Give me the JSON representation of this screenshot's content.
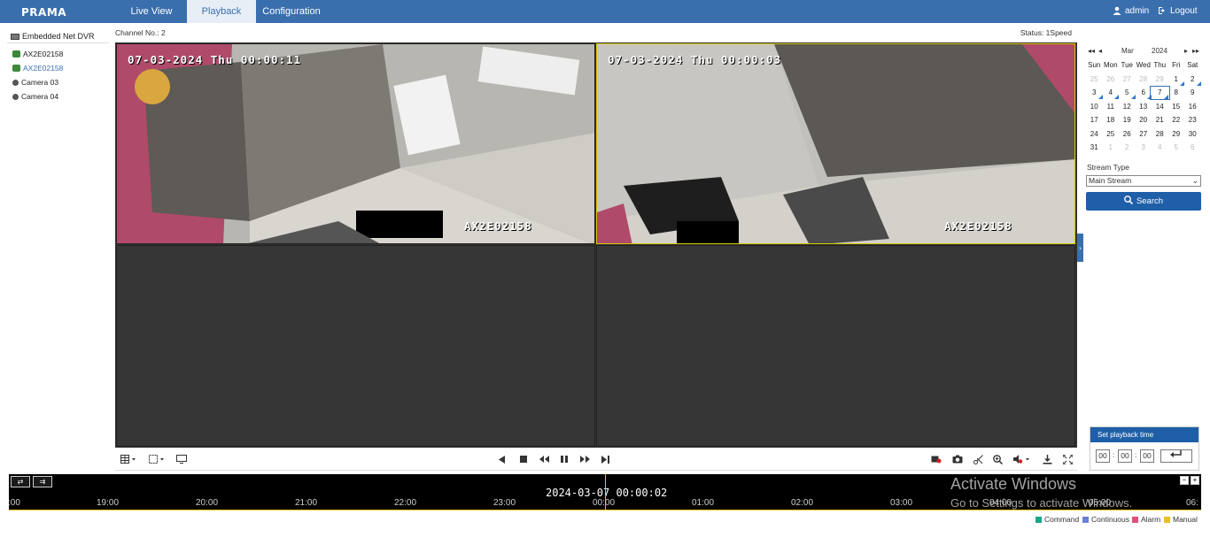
{
  "app": {
    "logo": "PRAMA"
  },
  "nav": {
    "tabs": [
      "Live View",
      "Playback",
      "Configuration"
    ]
  },
  "user": {
    "name": "admin",
    "logout": "Logout"
  },
  "tree": {
    "root": "Embedded Net DVR",
    "channels": [
      "AX2E02158",
      "AX2E02158",
      "Camera 03",
      "Camera 04"
    ]
  },
  "player": {
    "channel_no": "Channel No.: 2",
    "status": "Status: 1Speed",
    "cells": [
      {
        "osd_time": "07-03-2024 Thu 00:00:11",
        "osd_name": "AX2E02158"
      },
      {
        "osd_time": "07-03-2024 Thu 00:00:03",
        "osd_name": "AX2E02158"
      }
    ]
  },
  "calendar": {
    "month": "Mar",
    "year": "2024",
    "weekdays": [
      "Sun",
      "Mon",
      "Tue",
      "Wed",
      "Thu",
      "Fri",
      "Sat"
    ],
    "days": [
      [
        "25",
        "26",
        "27",
        "28",
        "29",
        "1",
        "2"
      ],
      [
        "3",
        "4",
        "5",
        "6",
        "7",
        "8",
        "9"
      ],
      [
        "10",
        "11",
        "12",
        "13",
        "14",
        "15",
        "16"
      ],
      [
        "17",
        "18",
        "19",
        "20",
        "21",
        "22",
        "23"
      ],
      [
        "24",
        "25",
        "26",
        "27",
        "28",
        "29",
        "30"
      ],
      [
        "31",
        "1",
        "2",
        "3",
        "4",
        "5",
        "6"
      ]
    ],
    "selected": "7"
  },
  "stream": {
    "label": "Stream Type",
    "value": "Main Stream"
  },
  "search_label": "Search",
  "playback_time": {
    "title": "Set playback time",
    "h": "00",
    "m": "00",
    "s": "00"
  },
  "timeline": {
    "current": "2024-03-07 00:00:02",
    "ticks": [
      ":00",
      "19:00",
      "20:00",
      "21:00",
      "22:00",
      "23:00",
      "00:00",
      "01:00",
      "02:00",
      "03:00",
      "04:00",
      "05:00",
      "06:"
    ]
  },
  "legend": [
    "Command",
    "Continuous",
    "Alarm",
    "Manual"
  ],
  "colors": {
    "accent": "#3a6fae",
    "command": "#1aa58a",
    "continuous": "#6a7fd8",
    "alarm": "#e0507a",
    "manual": "#e8c020"
  },
  "watermark": {
    "line1": "Activate Windows",
    "line2": "Go to Settings to activate Windows."
  }
}
